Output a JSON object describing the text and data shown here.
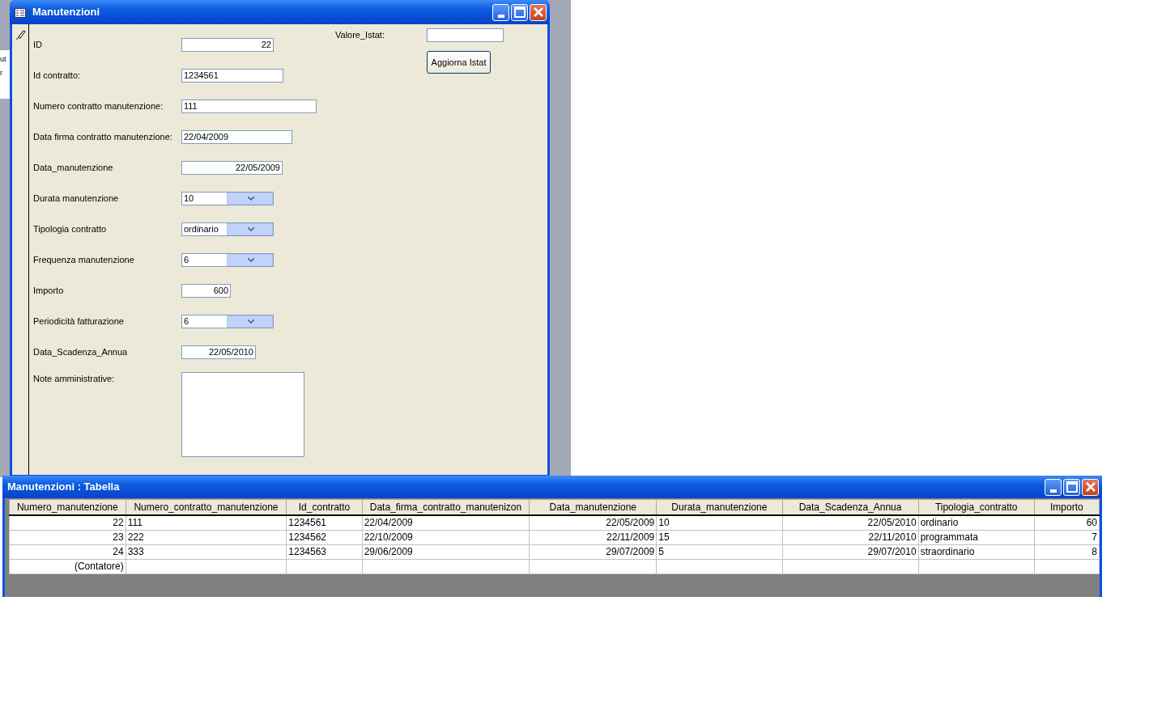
{
  "background_window": {
    "fragments": [
      "ut",
      "r"
    ]
  },
  "form_window": {
    "title": "Manutenzioni",
    "fields": [
      {
        "label": "ID",
        "kind": "text",
        "value": "22"
      },
      {
        "label": "Id contratto:",
        "kind": "text",
        "value": "1234561"
      },
      {
        "label": "Numero contratto manutenzione:",
        "kind": "text",
        "value": "111"
      },
      {
        "label": "Data firma contratto manutenzione:",
        "kind": "text",
        "value": "22/04/2009"
      },
      {
        "label": "Data_manutenzione",
        "kind": "text",
        "value": "22/05/2009"
      },
      {
        "label": "Durata manutenzione",
        "kind": "combo",
        "value": "10"
      },
      {
        "label": "Tipologia contratto",
        "kind": "combo",
        "value": "ordinario"
      },
      {
        "label": "Frequenza manutenzione",
        "kind": "combo",
        "value": "6"
      },
      {
        "label": "Importo",
        "kind": "text",
        "value": "600"
      },
      {
        "label": "Periodicità fatturazione",
        "kind": "combo",
        "value": "6"
      },
      {
        "label": "Data_Scadenza_Annua",
        "kind": "text",
        "value": "22/05/2010"
      },
      {
        "label": "Note amministrative:",
        "kind": "memo"
      }
    ],
    "istat": {
      "label": "Valore_Istat:",
      "button": "Aggiorna Istat"
    }
  },
  "table_window": {
    "title": "Manutenzioni : Tabella",
    "columns": [
      "Numero_manutenzione",
      "Numero_contratto_manutenzione",
      "Id_contratto",
      "Data_firma_contratto_manutenizon",
      "Data_manutenzione",
      "Durata_manutenzione",
      "Data_Scadenza_Annua",
      "Tipologia_contratto",
      "Importo"
    ],
    "rows": [
      [
        "22",
        "111",
        "1234561",
        "22/04/2009",
        "22/05/2009",
        "10",
        "22/05/2010",
        "ordinario",
        "60"
      ],
      [
        "23",
        "222",
        "1234562",
        "22/10/2009",
        "22/11/2009",
        "15",
        "22/11/2010",
        "programmata",
        "7"
      ],
      [
        "24",
        "333",
        "1234563",
        "29/06/2009",
        "29/07/2009",
        "5",
        "29/07/2010",
        "straordinario",
        "8"
      ],
      [
        "(Contatore)",
        "",
        "",
        "",
        "",
        "",
        "",
        "",
        ""
      ]
    ]
  }
}
